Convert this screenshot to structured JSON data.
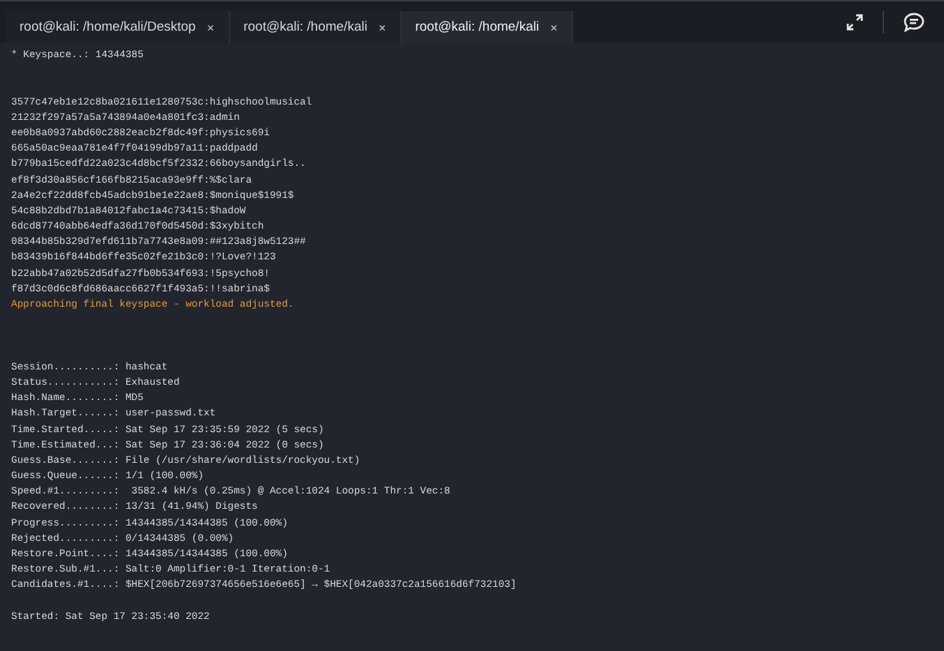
{
  "tabs": [
    {
      "label": "root@kali: /home/kali/Desktop",
      "close": "×",
      "selected": false
    },
    {
      "label": "root@kali: /home/kali",
      "close": "×",
      "selected": false
    },
    {
      "label": "root@kali: /home/kali",
      "close": "×",
      "selected": true
    }
  ],
  "terminal": {
    "lines": [
      {
        "kind": "normal",
        "text": "* Keyspace..: 14344385"
      },
      {
        "kind": "blank"
      },
      {
        "kind": "blank"
      },
      {
        "kind": "normal",
        "text": "3577c47eb1e12c8ba021611e1280753c:highschoolmusical"
      },
      {
        "kind": "normal",
        "text": "21232f297a57a5a743894a0e4a801fc3:admin"
      },
      {
        "kind": "normal",
        "text": "ee0b8a0937abd60c2882eacb2f8dc49f:physics69i"
      },
      {
        "kind": "normal",
        "text": "665a50ac9eaa781e4f7f04199db97a11:paddpadd"
      },
      {
        "kind": "normal",
        "text": "b779ba15cedfd22a023c4d8bcf5f2332:66boysandgirls.."
      },
      {
        "kind": "normal",
        "text": "ef8f3d30a856cf166fb8215aca93e9ff:%$clara"
      },
      {
        "kind": "normal",
        "text": "2a4e2cf22dd8fcb45adcb91be1e22ae8:$monique$1991$"
      },
      {
        "kind": "normal",
        "text": "54c88b2dbd7b1a84012fabc1a4c73415:$hadoW"
      },
      {
        "kind": "normal",
        "text": "6dcd87740abb64edfa36d170f0d5450d:$3xybitch"
      },
      {
        "kind": "normal",
        "text": "08344b85b329d7efd611b7a7743e8a09:##123a8j8w5123##"
      },
      {
        "kind": "normal",
        "text": "b83439b16f844bd6ffe35c02fe21b3c0:!?Love?!123"
      },
      {
        "kind": "normal",
        "text": "b22abb47a02b52d5dfa27fb0b534f693:!5psycho8!"
      },
      {
        "kind": "normal",
        "text": "f87d3c0d6c8fd686aacc6627f1f493a5:!!sabrina$"
      },
      {
        "kind": "warning",
        "text": "Approaching final keyspace - workload adjusted."
      },
      {
        "kind": "blank"
      },
      {
        "kind": "blank"
      },
      {
        "kind": "blank"
      },
      {
        "kind": "normal",
        "text": "Session..........: hashcat"
      },
      {
        "kind": "normal",
        "text": "Status...........: Exhausted"
      },
      {
        "kind": "normal",
        "text": "Hash.Name........: MD5"
      },
      {
        "kind": "normal",
        "text": "Hash.Target......: user-passwd.txt"
      },
      {
        "kind": "normal",
        "text": "Time.Started.....: Sat Sep 17 23:35:59 2022 (5 secs)"
      },
      {
        "kind": "normal",
        "text": "Time.Estimated...: Sat Sep 17 23:36:04 2022 (0 secs)"
      },
      {
        "kind": "normal",
        "text": "Guess.Base.......: File (/usr/share/wordlists/rockyou.txt)"
      },
      {
        "kind": "normal",
        "text": "Guess.Queue......: 1/1 (100.00%)"
      },
      {
        "kind": "normal",
        "text": "Speed.#1.........:  3582.4 kH/s (0.25ms) @ Accel:1024 Loops:1 Thr:1 Vec:8"
      },
      {
        "kind": "normal",
        "text": "Recovered........: 13/31 (41.94%) Digests"
      },
      {
        "kind": "normal",
        "text": "Progress.........: 14344385/14344385 (100.00%)"
      },
      {
        "kind": "normal",
        "text": "Rejected.........: 0/14344385 (0.00%)"
      },
      {
        "kind": "normal",
        "text": "Restore.Point....: 14344385/14344385 (100.00%)"
      },
      {
        "kind": "normal",
        "text": "Restore.Sub.#1...: Salt:0 Amplifier:0-1 Iteration:0-1"
      },
      {
        "kind": "normal",
        "text": "Candidates.#1....: $HEX[206b72697374656e516e6e65] → $HEX[042a0337c2a156616d6f732103]"
      },
      {
        "kind": "blank"
      },
      {
        "kind": "normal",
        "text": "Started: Sat Sep 17 23:35:40 2022"
      }
    ]
  }
}
